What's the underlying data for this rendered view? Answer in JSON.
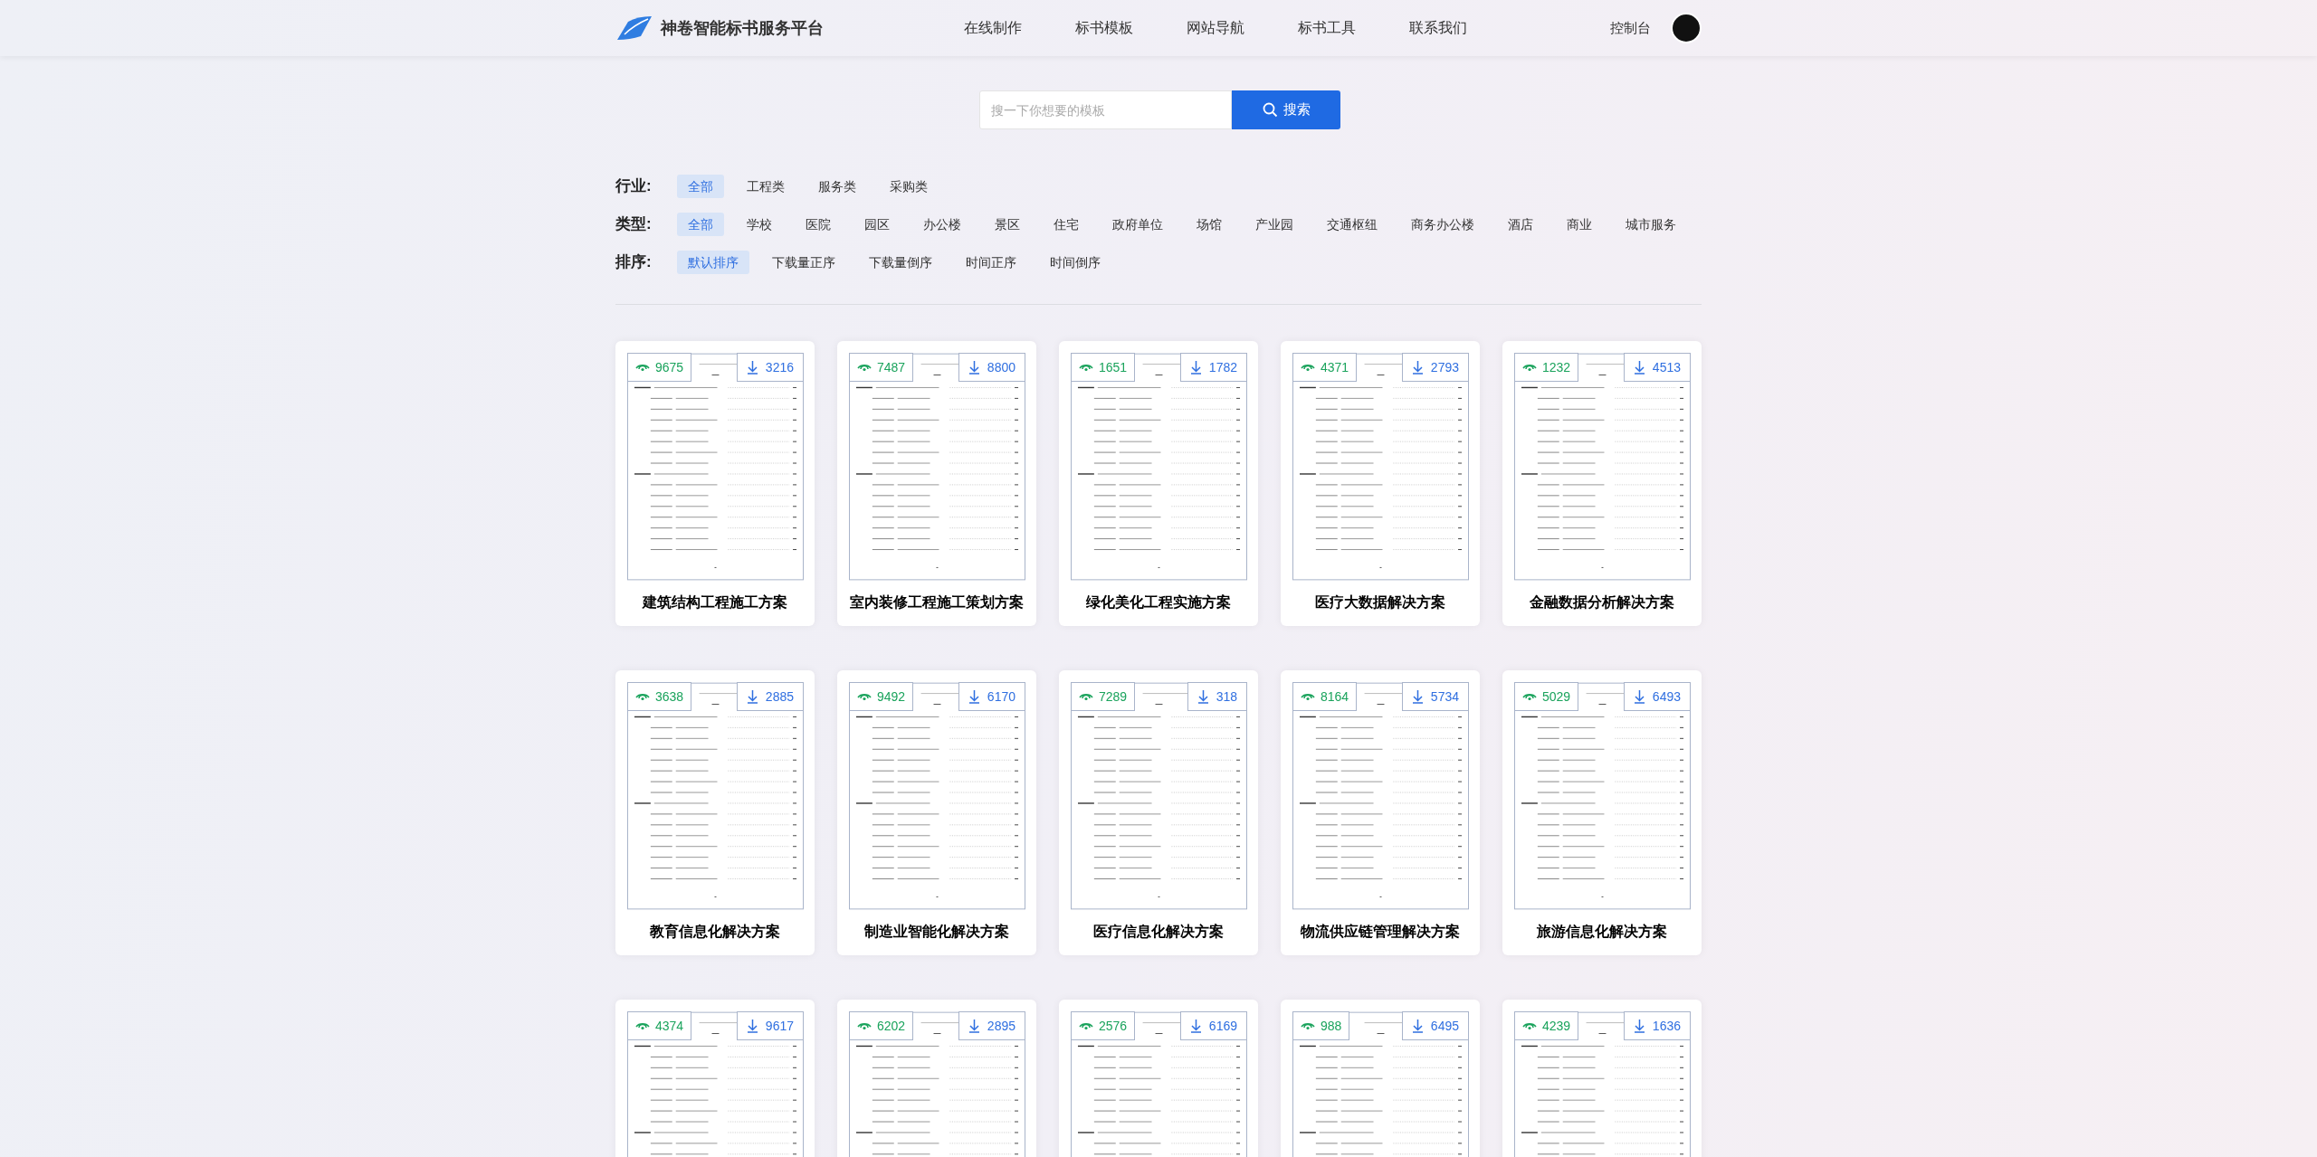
{
  "header": {
    "brand": "神卷智能标书服务平台",
    "nav": [
      "在线制作",
      "标书模板",
      "网站导航",
      "标书工具",
      "联系我们"
    ],
    "console_link": "控制台"
  },
  "search": {
    "placeholder": "搜一下你想要的模板",
    "button": "搜索"
  },
  "filters": [
    {
      "label": "行业:",
      "options": [
        {
          "label": "全部",
          "selected": true
        },
        {
          "label": "工程类",
          "selected": false
        },
        {
          "label": "服务类",
          "selected": false
        },
        {
          "label": "采购类",
          "selected": false
        }
      ]
    },
    {
      "label": "类型:",
      "options": [
        {
          "label": "全部",
          "selected": true
        },
        {
          "label": "学校",
          "selected": false
        },
        {
          "label": "医院",
          "selected": false
        },
        {
          "label": "园区",
          "selected": false
        },
        {
          "label": "办公楼",
          "selected": false
        },
        {
          "label": "景区",
          "selected": false
        },
        {
          "label": "住宅",
          "selected": false
        },
        {
          "label": "政府单位",
          "selected": false
        },
        {
          "label": "场馆",
          "selected": false
        },
        {
          "label": "产业园",
          "selected": false
        },
        {
          "label": "交通枢纽",
          "selected": false
        },
        {
          "label": "商务办公楼",
          "selected": false
        },
        {
          "label": "酒店",
          "selected": false
        },
        {
          "label": "商业",
          "selected": false
        },
        {
          "label": "城市服务",
          "selected": false
        }
      ]
    },
    {
      "label": "排序:",
      "options": [
        {
          "label": "默认排序",
          "selected": true
        },
        {
          "label": "下载量正序",
          "selected": false
        },
        {
          "label": "下载量倒序",
          "selected": false
        },
        {
          "label": "时间正序",
          "selected": false
        },
        {
          "label": "时间倒序",
          "selected": false
        }
      ]
    }
  ],
  "cards": [
    {
      "views": "9675",
      "downloads": "3216",
      "title": "建筑结构工程施工方案"
    },
    {
      "views": "7487",
      "downloads": "8800",
      "title": "室内装修工程施工策划方案"
    },
    {
      "views": "1651",
      "downloads": "1782",
      "title": "绿化美化工程实施方案"
    },
    {
      "views": "4371",
      "downloads": "2793",
      "title": "医疗大数据解决方案"
    },
    {
      "views": "1232",
      "downloads": "4513",
      "title": "金融数据分析解决方案"
    },
    {
      "views": "3638",
      "downloads": "2885",
      "title": "教育信息化解决方案"
    },
    {
      "views": "9492",
      "downloads": "6170",
      "title": "制造业智能化解决方案"
    },
    {
      "views": "7289",
      "downloads": "318",
      "title": "医疗信息化解决方案"
    },
    {
      "views": "8164",
      "downloads": "5734",
      "title": "物流供应链管理解决方案"
    },
    {
      "views": "5029",
      "downloads": "6493",
      "title": "旅游信息化解决方案"
    },
    {
      "views": "4374",
      "downloads": "9617"
    },
    {
      "views": "6202",
      "downloads": "2895"
    },
    {
      "views": "2576",
      "downloads": "6169"
    },
    {
      "views": "988",
      "downloads": "6495"
    },
    {
      "views": "4239",
      "downloads": "1636"
    }
  ]
}
